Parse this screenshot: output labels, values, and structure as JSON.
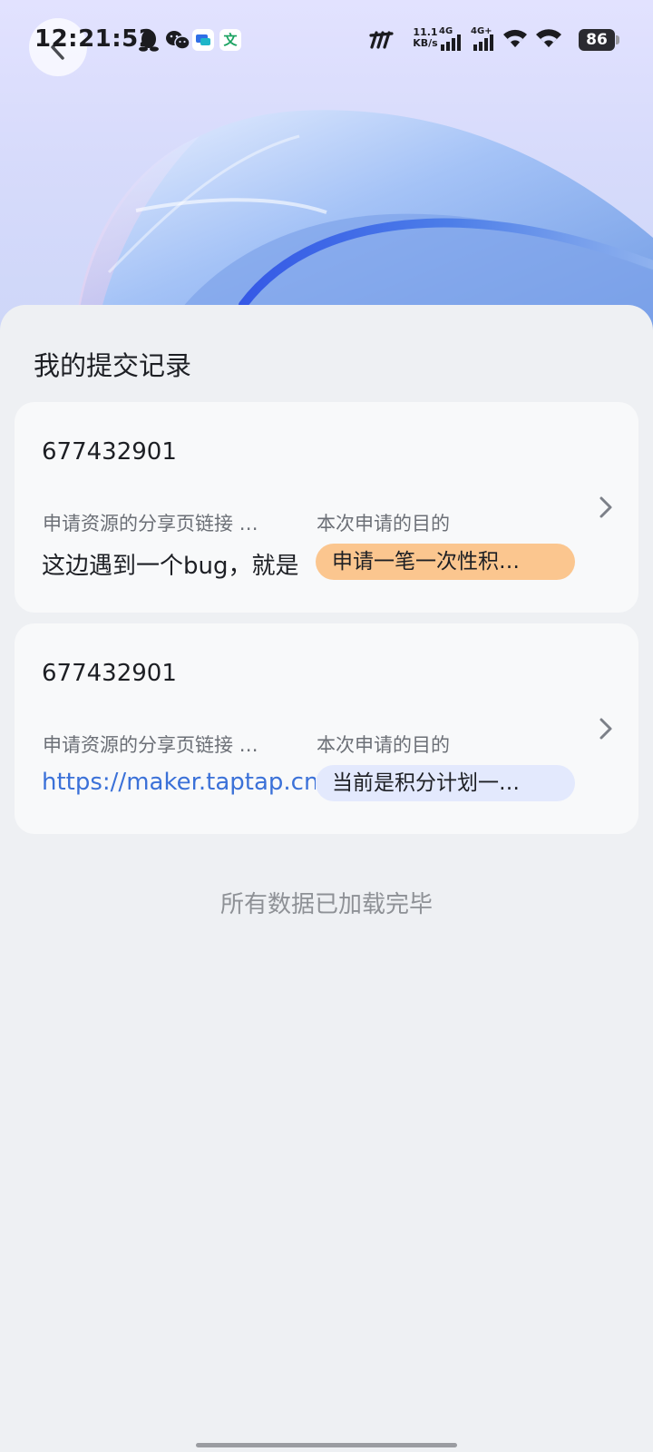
{
  "status_bar": {
    "time": "12:21:52",
    "netspeed_value": "11.1",
    "netspeed_unit": "KB/s",
    "network_1": "4G",
    "network_2": "4G+",
    "battery": "86",
    "notification_icons": [
      "qq-icon",
      "wechat-icon",
      "message-app-icon",
      "translate-app-icon"
    ],
    "translate_glyph": "文"
  },
  "header": {
    "back_icon": "chevron-left-icon"
  },
  "page": {
    "title": "我的提交记录",
    "footer": "所有数据已加载完毕"
  },
  "records": [
    {
      "id": "677432901",
      "label_link": "申请资源的分享页链接 …",
      "label_purpose": "本次申请的目的",
      "value_link": "这边遇到一个bug，就是",
      "value_is_link": false,
      "purpose": "申请一笔一次性积…",
      "purpose_color": "#fbc68f"
    },
    {
      "id": "677432901",
      "label_link": "申请资源的分享页链接 …",
      "label_purpose": "本次申请的目的",
      "value_link": "https://maker.taptap.cn",
      "value_is_link": true,
      "purpose": "当前是积分计划一…",
      "purpose_color": "#e3e9fd"
    }
  ],
  "colors": {
    "background": "#eef0f3",
    "card": "#f8f9fa",
    "link": "#3b71d8",
    "hero_accent": "#3f6ee8"
  }
}
